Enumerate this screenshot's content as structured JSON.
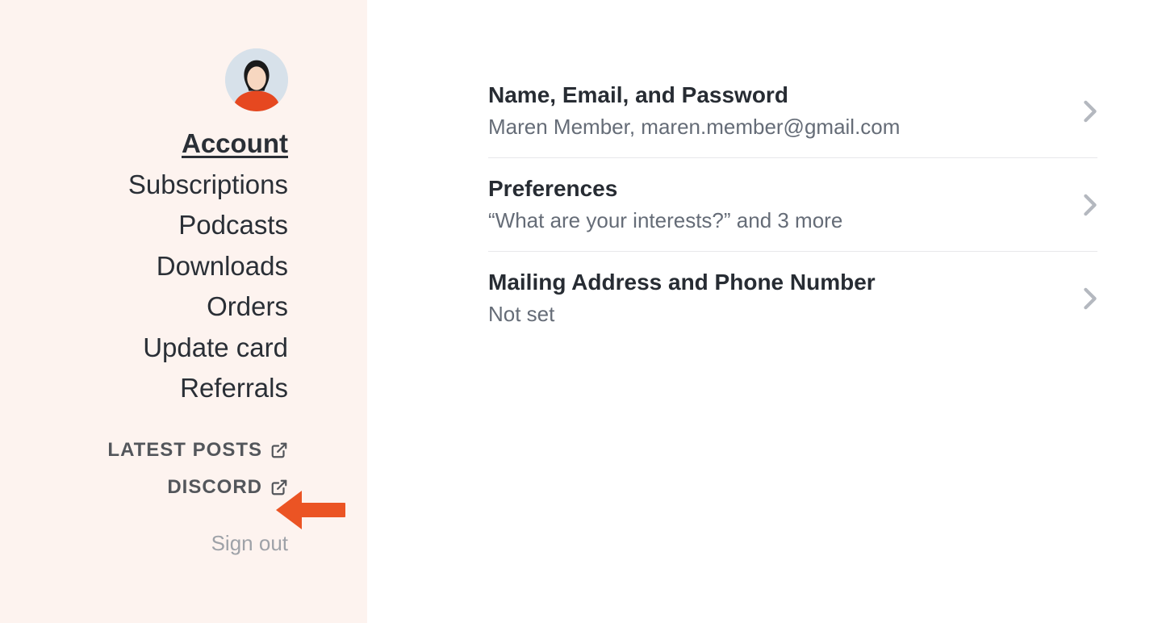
{
  "sidebar": {
    "nav": [
      {
        "label": "Account",
        "active": true
      },
      {
        "label": "Subscriptions",
        "active": false
      },
      {
        "label": "Podcasts",
        "active": false
      },
      {
        "label": "Downloads",
        "active": false
      },
      {
        "label": "Orders",
        "active": false
      },
      {
        "label": "Update card",
        "active": false
      },
      {
        "label": "Referrals",
        "active": false
      }
    ],
    "links": [
      {
        "label": "LATEST POSTS"
      },
      {
        "label": "DISCORD"
      }
    ],
    "signout_label": "Sign out"
  },
  "settings": [
    {
      "title": "Name, Email, and Password",
      "sub": "Maren Member, maren.member@gmail.com"
    },
    {
      "title": "Preferences",
      "sub": "“What are your interests?” and 3 more"
    },
    {
      "title": "Mailing Address and Phone Number",
      "sub": "Not set"
    }
  ]
}
